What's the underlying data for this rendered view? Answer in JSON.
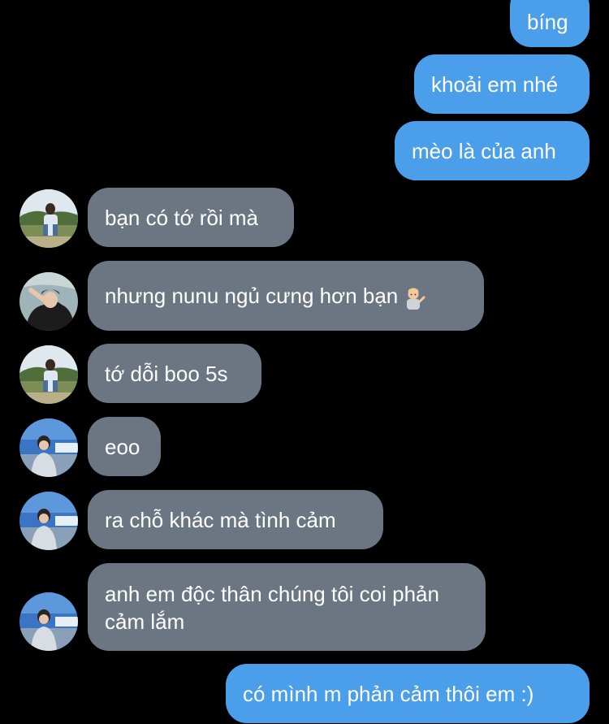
{
  "messages": {
    "m1": "bíng",
    "m2": "khoải em nhé",
    "m3": "mèo là của anh",
    "m4": "bạn có tớ rồi mà",
    "m5": "nhưng nunu ngủ cưng hơn bạn",
    "m6": "tớ dỗi boo 5s",
    "m7": "eoo",
    "m8": "ra chỗ khác mà tình cảm",
    "m9": "anh em độc thân chúng tôi coi phản cảm lắm",
    "m10": "có mình m phản cảm thôi em :)"
  },
  "icons": {
    "m5_emoji": "person-tipping-hand-emoji"
  },
  "colors": {
    "outgoing_bubble": "#4a9eea",
    "incoming_bubble": "#6b7682",
    "background": "#000000",
    "text": "#ffffff"
  }
}
